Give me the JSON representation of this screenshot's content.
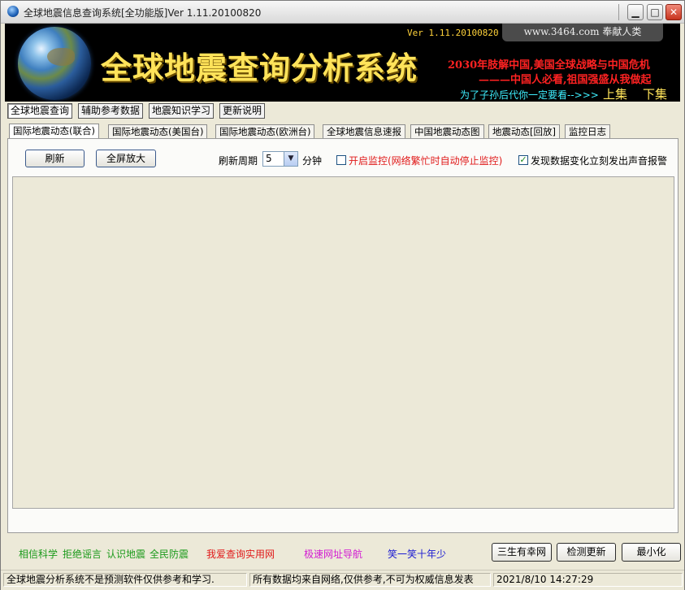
{
  "window": {
    "title": "全球地震信息查询系统[全功能版]Ver 1.11.20100820"
  },
  "banner": {
    "version": "Ver 1.11.20100820",
    "site": "www.3464.com 奉献人类",
    "title": "全球地震查询分析系统",
    "slogan1": "2030年肢解中国,美国全球战略与中国危机",
    "slogan2": "———中国人必看,祖国强盛从我做起",
    "hint": "为了子孙后代你一定要看-->>>",
    "prev": "上集",
    "next": "下集"
  },
  "main_buttons": [
    "全球地震查询",
    "辅助参考数据",
    "地震知识学习",
    "更新说明"
  ],
  "tabs": [
    "国际地震动态(联合)",
    "国际地震动态(美国台)",
    "国际地震动态(欧洲台)",
    "全球地震信息速报",
    "中国地震动态图",
    "地震动态[回放]",
    "监控日志"
  ],
  "toolbar": {
    "refresh": "刷新",
    "fullscreen": "全屏放大",
    "period_label": "刷新周期",
    "period_value": "5",
    "period_unit": "分钟",
    "monitor_label": "开启监控(网络繁忙时自动停止监控)",
    "monitor_checked": false,
    "alarm_label": "发现数据变化立刻发出声音报警",
    "alarm_checked": true
  },
  "footer": {
    "links": [
      {
        "text": "相信科学",
        "color": "#1a9a1a"
      },
      {
        "text": "拒绝谣言",
        "color": "#1a9a1a"
      },
      {
        "text": "认识地震",
        "color": "#1a9a1a"
      },
      {
        "text": "全民防震",
        "color": "#1a9a1a"
      },
      {
        "text": "我爱查询实用网",
        "color": "#e01a1a"
      },
      {
        "text": "极速网址导航",
        "color": "#d21ad2"
      },
      {
        "text": "笑一笑十年少",
        "color": "#1a1ad2"
      }
    ],
    "buttons": [
      "三生有幸网",
      "检测更新",
      "最小化"
    ]
  },
  "status": {
    "left": "全球地震分析系统不是预测软件仅供参考和学习.",
    "middle": "所有数据均来自网络,仅供参考,不可为权威信息发表",
    "time": "2021/8/10 14:27:29"
  }
}
